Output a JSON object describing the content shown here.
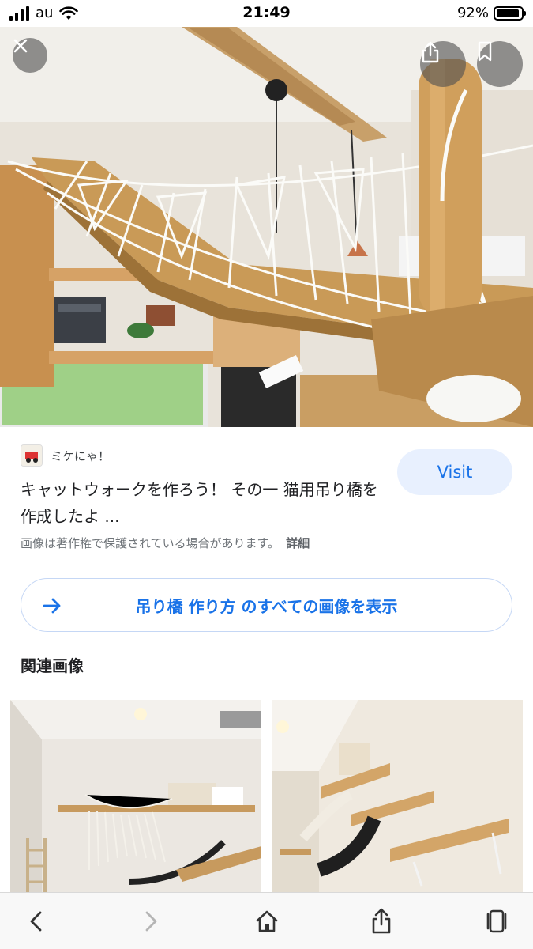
{
  "status_bar": {
    "carrier": "au",
    "time": "21:49",
    "battery_percent": "92%",
    "battery_level": 0.92
  },
  "hero": {
    "close_icon": "close-icon",
    "share_icon": "share-icon",
    "save_icon": "bookmark-icon"
  },
  "result": {
    "source_name": "ミケにゃ！",
    "title": "キャットウォークを作ろう！ その一 猫用吊り橋を作成したよ ...",
    "visit_label": "Visit",
    "copyright_notice": "画像は著作権で保護されている場合があります。",
    "details_label": "詳細"
  },
  "all_images": {
    "label": "吊り橋 作り方 のすべての画像を表示"
  },
  "related": {
    "heading": "関連画像"
  },
  "toolbar": {
    "back_icon": "chevron-left-icon",
    "forward_icon": "chevron-right-icon",
    "home_icon": "home-icon",
    "share_icon": "share-icon",
    "tabs_icon": "tabs-icon"
  },
  "colors": {
    "accent": "#1a73e8",
    "visit_bg": "#e8f0fe"
  }
}
